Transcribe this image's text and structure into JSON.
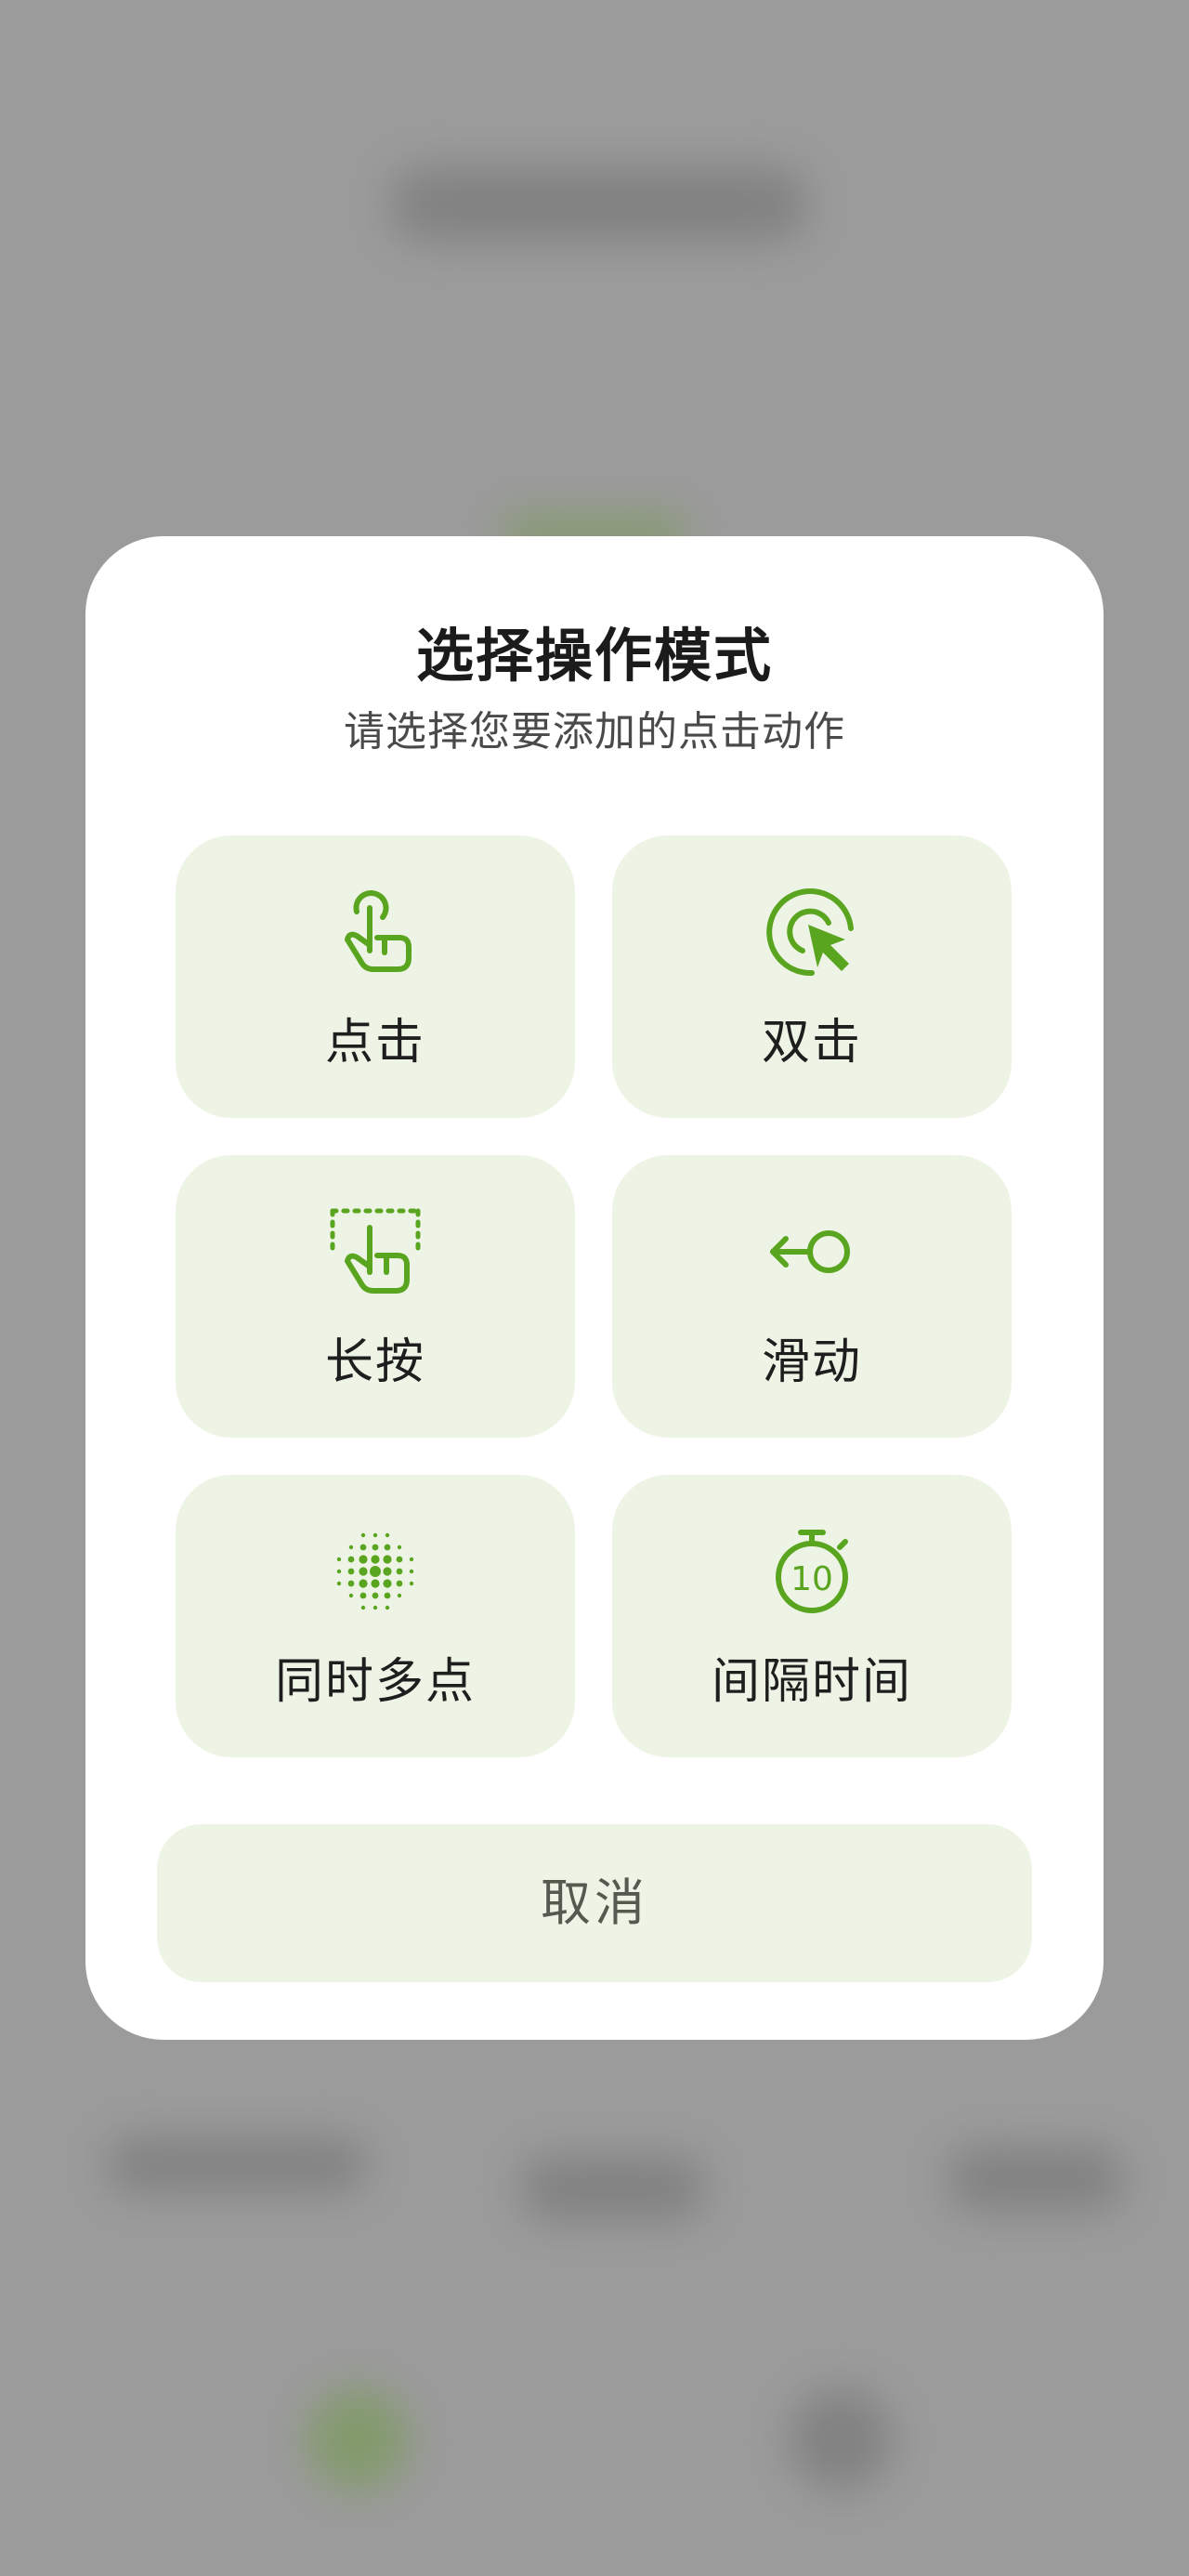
{
  "dialog": {
    "title": "选择操作模式",
    "subtitle": "请选择您要添加的点击动作",
    "options": [
      {
        "label": "点击",
        "icon": "tap-icon"
      },
      {
        "label": "双击",
        "icon": "double-tap-icon"
      },
      {
        "label": "长按",
        "icon": "long-press-icon"
      },
      {
        "label": "滑动",
        "icon": "swipe-icon"
      },
      {
        "label": "同时多点",
        "icon": "multi-point-icon"
      },
      {
        "label": "间隔时间",
        "icon": "timer-icon"
      }
    ],
    "timer_icon_number": "10",
    "cancel_label": "取消"
  },
  "colors": {
    "accent": "#5aa51f",
    "tile_bg": "#eef4e5",
    "overlay": "#9b9b9b"
  }
}
